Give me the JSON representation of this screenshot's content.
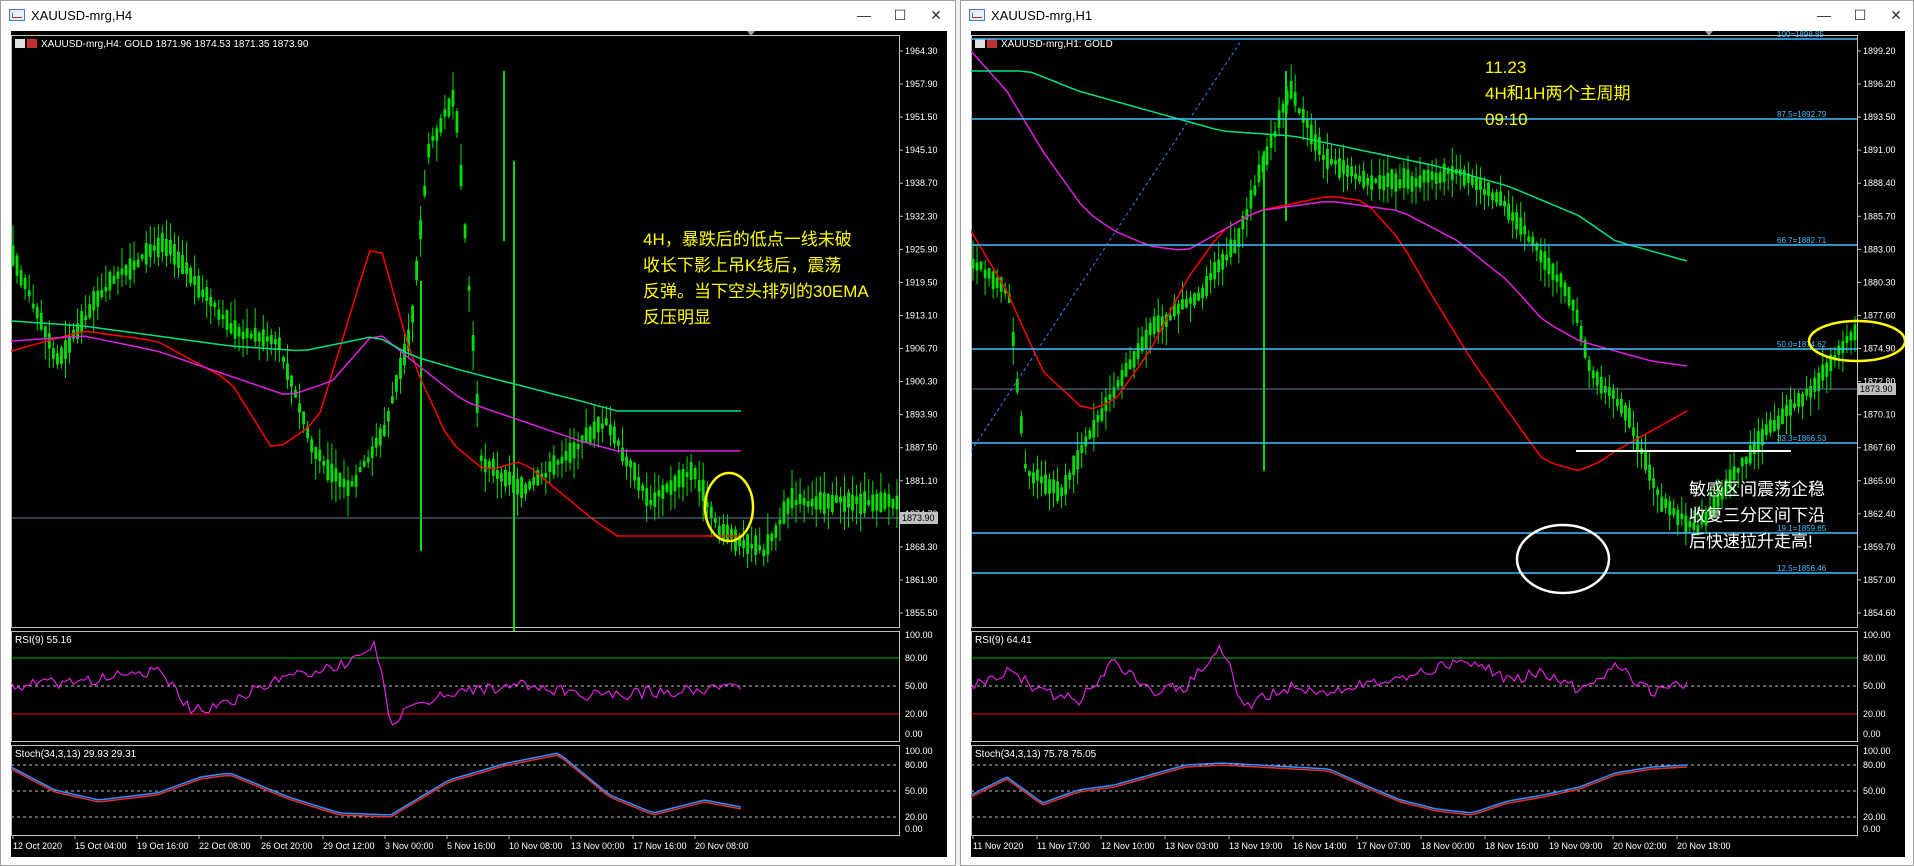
{
  "left": {
    "window_title": "XAUUSD-mrg,H4",
    "chart_header": "XAUUSD-mrg,H4:  GOLD   1871.96 1874.53 1871.35 1873.90",
    "price_ticks": [
      "1964.30",
      "1957.90",
      "1951.50",
      "1945.10",
      "1938.70",
      "1932.30",
      "1925.90",
      "1919.50",
      "1913.10",
      "1906.70",
      "1900.30",
      "1893.90",
      "1887.50",
      "1881.10",
      "1874.70",
      "1868.30",
      "1861.90",
      "1855.50"
    ],
    "current_price": "1873.90",
    "rsi_header": "RSI(9) 55.16",
    "rsi_ticks": [
      "100.00",
      "80.00",
      "50.00",
      "20.00",
      "0.00"
    ],
    "stoch_header": "Stoch(34,3,13) 29.93 29.31",
    "stoch_ticks": [
      "100.00",
      "80.00",
      "50.00",
      "20.00",
      "0.00"
    ],
    "time_labels": [
      "12 Oct 2020",
      "15 Oct 04:00",
      "19 Oct 16:00",
      "22 Oct 08:00",
      "26 Oct 20:00",
      "29 Oct 12:00",
      "3 Nov 00:00",
      "5 Nov 16:00",
      "10 Nov 08:00",
      "13 Nov 00:00",
      "17 Nov 16:00",
      "20 Nov 08:00"
    ],
    "annotation": [
      "4H，暴跌后的低点一线未破",
      "收长下影上吊K线后，震荡",
      "反弹。当下空头排列的30EMA",
      "反压明显"
    ]
  },
  "right": {
    "window_title": "XAUUSD-mrg,H1",
    "chart_header": "XAUUSD-mrg,H1:  GOLD",
    "price_ticks": [
      "1899.20",
      "1896.20",
      "1893.50",
      "1891.00",
      "1888.40",
      "1885.70",
      "1883.00",
      "1880.30",
      "1877.60",
      "1874.90",
      "1872.80",
      "1870.10",
      "1867.60",
      "1865.00",
      "1862.40",
      "1859.70",
      "1857.00",
      "1854.60"
    ],
    "current_price": "1873.90",
    "fib_labels": [
      "100=1898.85",
      "87.5=1892.79",
      "66.7=1882.71",
      "50.0=1874.62",
      "33.3=1866.53",
      "19.1=1859.65",
      "12.5=1856.46"
    ],
    "rsi_header": "RSI(9) 64.41",
    "rsi_ticks": [
      "100.00",
      "80.00",
      "50.00",
      "20.00",
      "0.00"
    ],
    "stoch_header": "Stoch(34,3,13) 75.78 75.05",
    "stoch_ticks": [
      "100.00",
      "80.00",
      "50.00",
      "20.00",
      "0.00"
    ],
    "time_labels": [
      "11 Nov 2020",
      "11 Nov 17:00",
      "12 Nov 10:00",
      "13 Nov 03:00",
      "13 Nov 19:00",
      "16 Nov 14:00",
      "17 Nov 07:00",
      "18 Nov 00:00",
      "18 Nov 16:00",
      "19 Nov 09:00",
      "20 Nov 02:00",
      "20 Nov 18:00"
    ],
    "annotation_top": [
      "11.23",
      "4H和1H两个主周期",
      "09:10"
    ],
    "annotation_side": [
      "敏感区间震荡企稳",
      "收复三分区间下沿",
      "后快速拉升走高!"
    ]
  },
  "colors": {
    "candle": "#00e000",
    "ema_red": "#ff0000",
    "ema_magenta": "#e020e0",
    "ema_green": "#00e080",
    "fib_line": "#40c0ff",
    "annotation_yellow": "#ffff00",
    "annotation_white": "#ffffff",
    "rsi_line": "#e020e0",
    "stoch_red": "#e03030",
    "stoch_blue": "#3090ff"
  }
}
